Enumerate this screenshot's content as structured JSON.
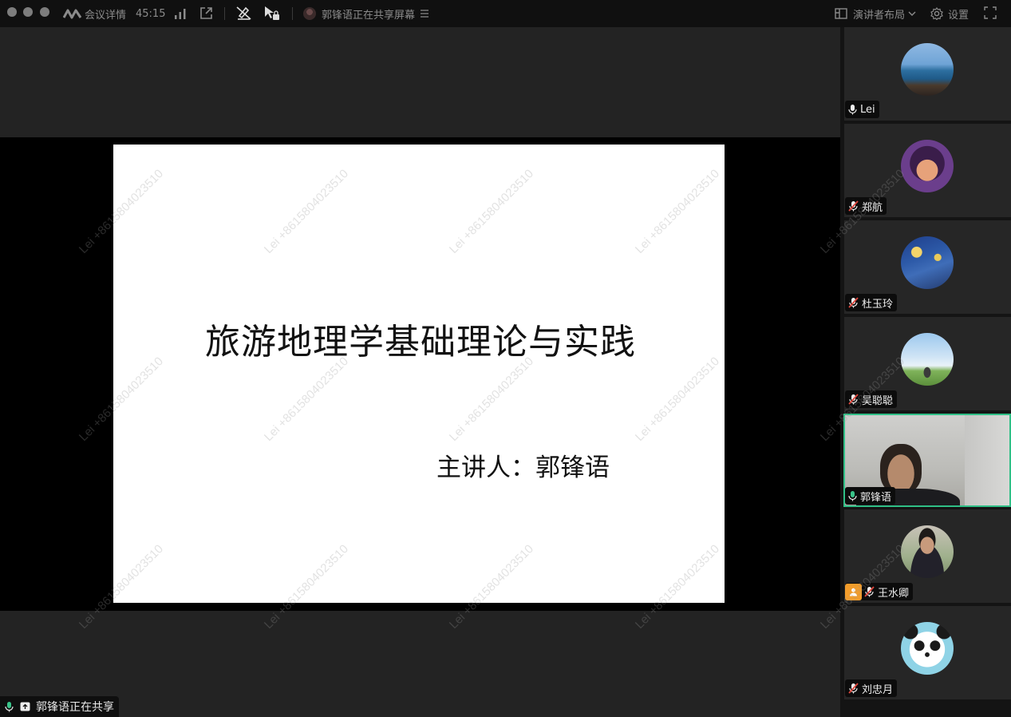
{
  "topbar": {
    "meeting_details": "会议详情",
    "duration": "45:15",
    "sharing_status": "郭锋语正在共享屏幕",
    "layout_label": "演讲者布局",
    "settings_label": "设置"
  },
  "slide": {
    "title": "旅游地理学基础理论与实践",
    "presenter": "主讲人：郭锋语"
  },
  "watermark": "Lei +8615804023510",
  "sharing_tag": "郭锋语正在共享",
  "participants": [
    {
      "name": "Lei",
      "mic": "on",
      "avatar": "seaside-photo"
    },
    {
      "name": "郑航",
      "mic": "muted",
      "avatar": "cartoon-girl"
    },
    {
      "name": "杜玉玲",
      "mic": "muted",
      "avatar": "starry-night"
    },
    {
      "name": "吴聪聪",
      "mic": "muted",
      "avatar": "sky-hiker"
    },
    {
      "name": "郭锋语",
      "mic": "speaking",
      "avatar": "video-feed"
    },
    {
      "name": "王水卿",
      "mic": "muted",
      "avatar": "man-in-suit",
      "host": true
    },
    {
      "name": "刘忠月",
      "mic": "muted",
      "avatar": "panda"
    }
  ],
  "colors": {
    "active_border": "#2fbf86",
    "speaking_mic": "#3ac48a",
    "host_badge": "#f29c2b"
  }
}
